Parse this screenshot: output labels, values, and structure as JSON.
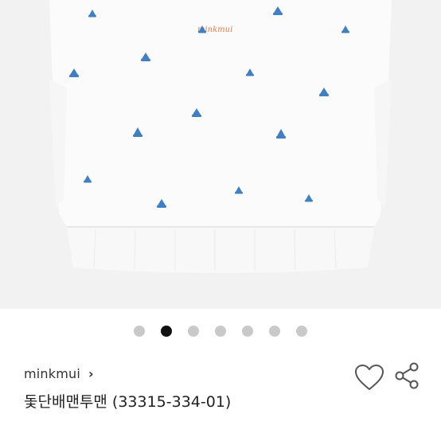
{
  "product_image": {
    "embroidery_text": "minkmui"
  },
  "carousel": {
    "total": 7,
    "active_index": 1
  },
  "product": {
    "brand": "minkmui",
    "brand_chevron": "›",
    "title": "돛단배맨투맨 (33315-334-01)"
  },
  "actions": {
    "like_icon": "heart-icon",
    "share_icon": "share-icon"
  },
  "colors": {
    "accent_active_dot": "#111111",
    "inactive_dot": "#c9c9c9",
    "boat_blue": "#3f7fc2",
    "embroidery_orange": "#e07a4a"
  }
}
